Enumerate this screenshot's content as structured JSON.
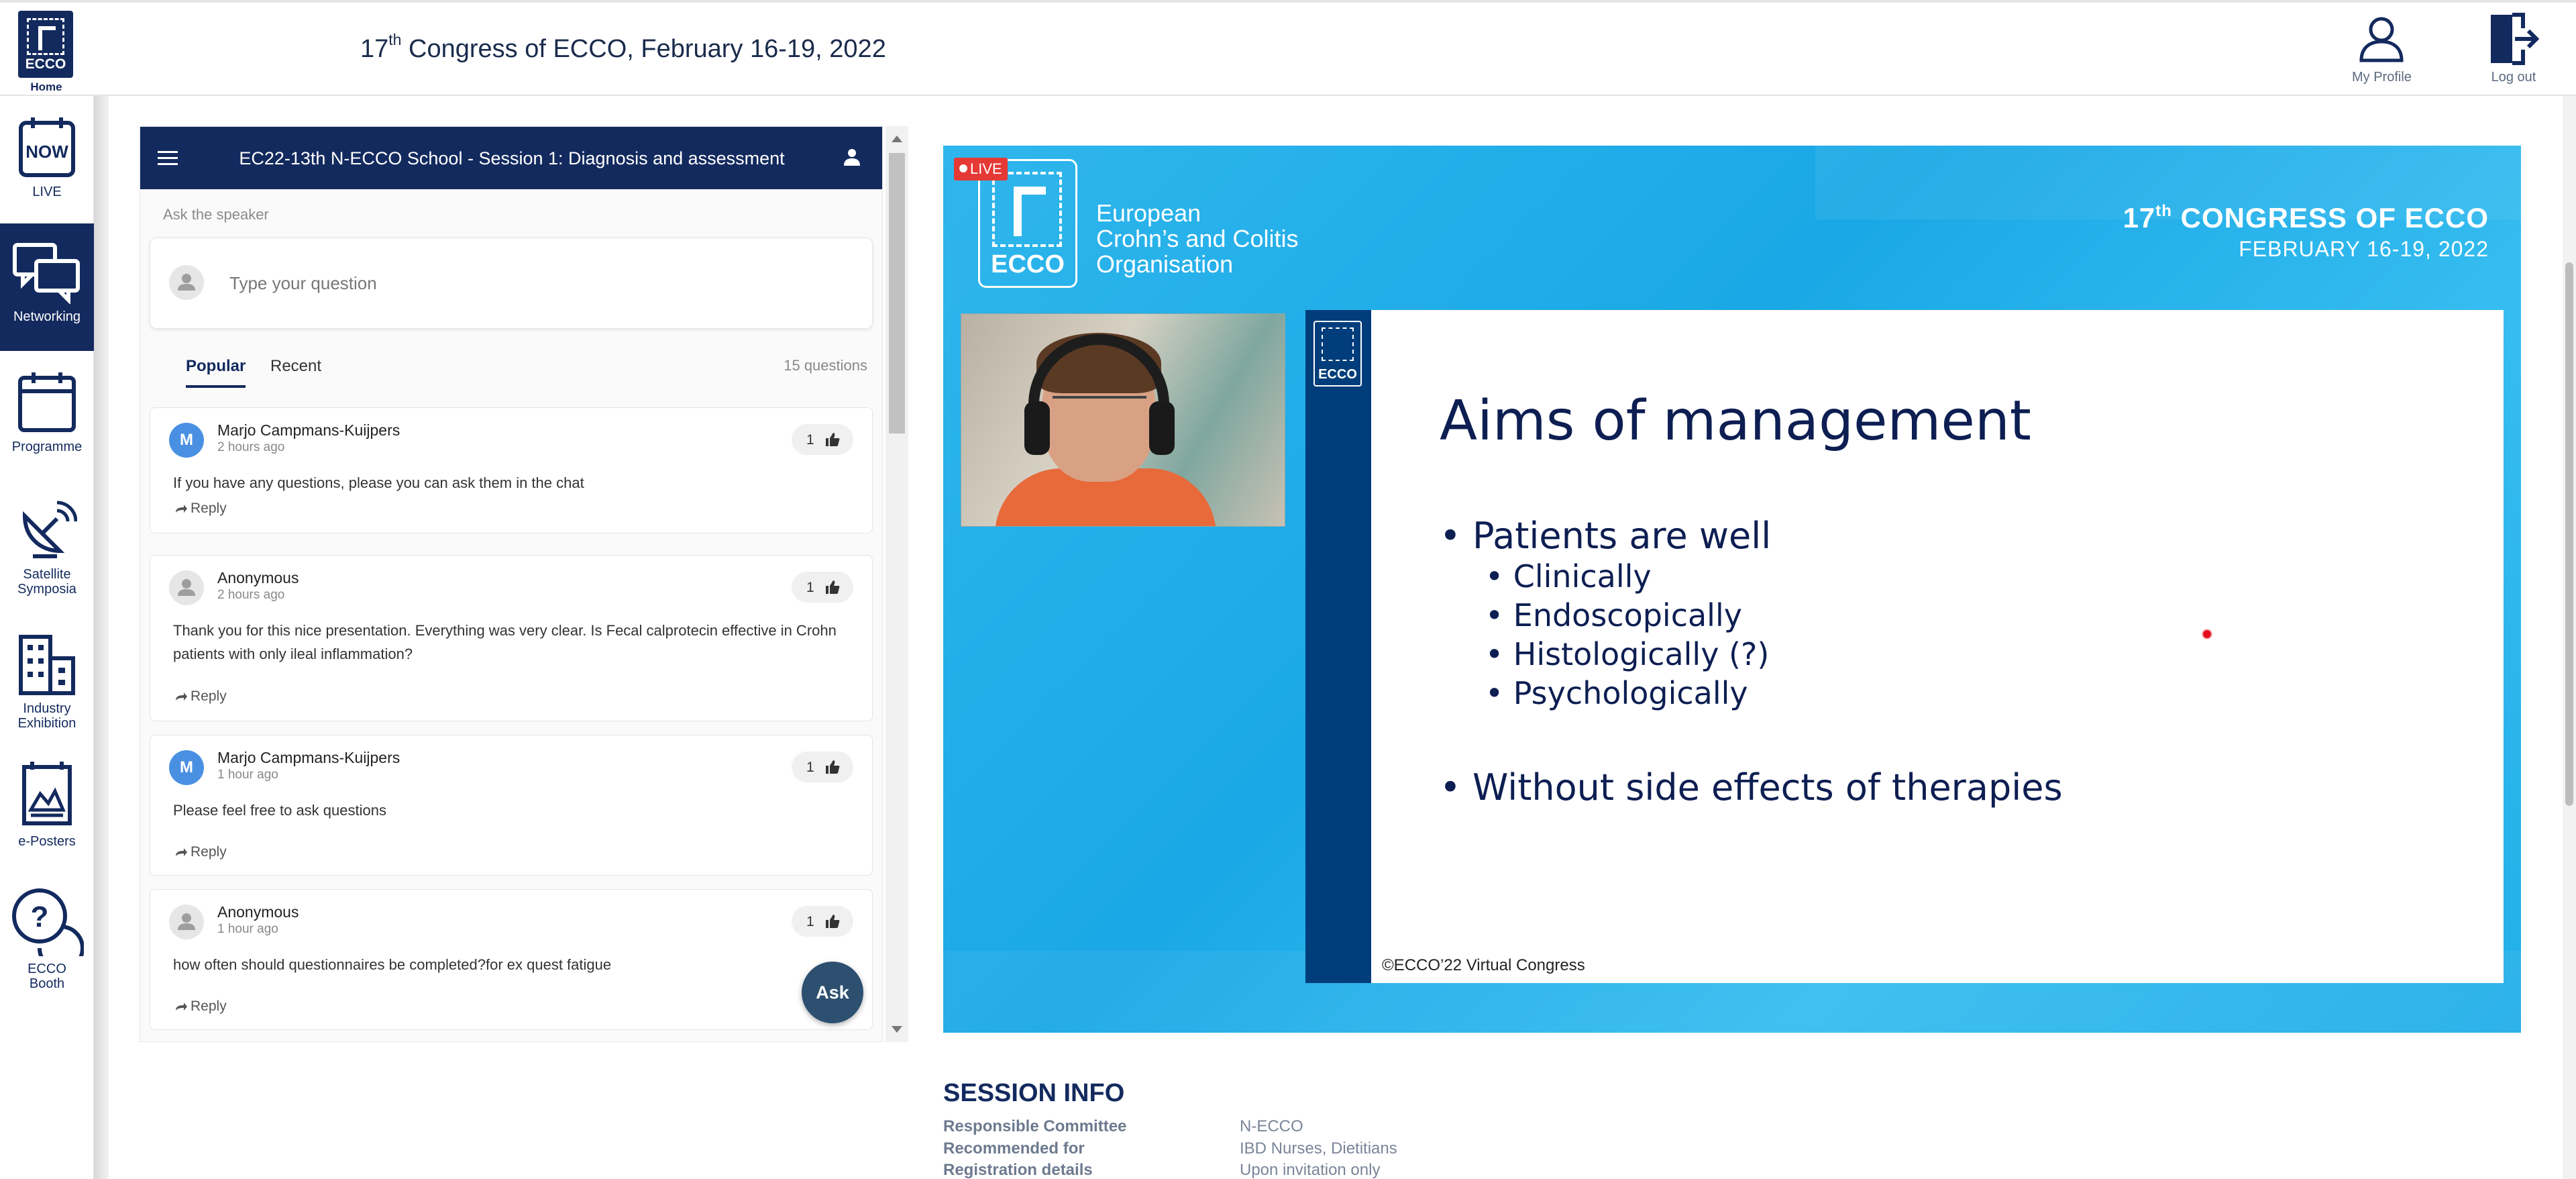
{
  "header": {
    "home_logo_text": "ECCO",
    "home_label": "Home",
    "title_prefix": "17",
    "title_sup": "th",
    "title_rest": " Congress of ECCO, February 16-19, 2022",
    "profile_label": "My Profile",
    "logout_label": "Log out"
  },
  "sidebar": {
    "items": [
      {
        "label": "LIVE",
        "icon": "now-icon",
        "icon_text": "NOW"
      },
      {
        "label": "Networking",
        "icon": "chat-bubbles-icon"
      },
      {
        "label": "Programme",
        "icon": "calendar-icon"
      },
      {
        "label1": "Satellite",
        "label2": "Symposia",
        "icon": "satellite-icon"
      },
      {
        "label1": "Industry",
        "label2": "Exhibition",
        "icon": "buildings-icon"
      },
      {
        "label": "e-Posters",
        "icon": "poster-icon"
      },
      {
        "label1": "ECCO",
        "label2": "Booth",
        "icon": "help-bubble-icon"
      }
    ]
  },
  "qa": {
    "session_title": "EC22-13th N-ECCO School - Session 1: Diagnosis and assessment",
    "ask_label": "Ask the speaker",
    "input_placeholder": "Type your question",
    "tabs": [
      "Popular",
      "Recent"
    ],
    "question_count": "15 questions",
    "reply_label": "Reply",
    "ask_button": "Ask",
    "questions": [
      {
        "initial": "M",
        "name": "Marjo Campmans-Kuijpers",
        "time": "2 hours ago",
        "likes": "1",
        "text": "If you have any questions, please you can ask them in the chat"
      },
      {
        "initial": "",
        "name": "Anonymous",
        "time": "2 hours ago",
        "likes": "1",
        "text": "Thank you for this nice presentation. Everything was very clear. Is Fecal calprotecin effective in Crohn patients with only ileal inflammation?"
      },
      {
        "initial": "M",
        "name": "Marjo Campmans-Kuijpers",
        "time": "1 hour ago",
        "likes": "1",
        "text": "Please feel free to ask questions"
      },
      {
        "initial": "",
        "name": "Anonymous",
        "time": "1 hour ago",
        "likes": "1",
        "text": "how often should questionnaires be completed?for ex quest fatigue"
      }
    ]
  },
  "video": {
    "live_badge": "LIVE",
    "logo_text": "ECCO",
    "org_line1": "European",
    "org_line2": "Crohn’s and Colitis",
    "org_line3": "Organisation",
    "congress_num": "17",
    "congress_sup": "th",
    "congress_rest": " CONGRESS OF ECCO",
    "congress_dates": "FEBRUARY 16-19, 2022",
    "slide": {
      "logo_text": "ECCO",
      "title": "Aims of management",
      "bullet1": "• Patients are well",
      "sub_bullets": [
        "• Clinically",
        "• Endoscopically",
        "• Histologically (?)",
        "• Psychologically"
      ],
      "bullet2": "• Without side effects of therapies",
      "copyright": "©ECCO’22 Virtual Congress"
    }
  },
  "session_info": {
    "title": "SESSION INFO",
    "rows": [
      {
        "key": "Responsible Committee",
        "value": "N-ECCO"
      },
      {
        "key": "Recommended for",
        "value": "IBD Nurses, Dietitians"
      },
      {
        "key": "Registration details",
        "value": "Upon invitation only"
      }
    ]
  },
  "colors": {
    "navy": "#132a5e",
    "slide_blue": "#1aa8e6",
    "live_red": "#e53935"
  }
}
